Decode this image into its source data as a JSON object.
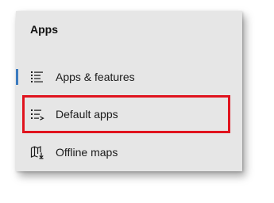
{
  "section": {
    "title": "Apps"
  },
  "nav": {
    "items": [
      {
        "label": "Apps & features",
        "icon": "apps-features-list-icon",
        "active": true
      },
      {
        "label": "Default apps",
        "icon": "default-apps-list-icon",
        "active": false
      },
      {
        "label": "Offline maps",
        "icon": "offline-map-download-icon",
        "active": false
      }
    ]
  },
  "colors": {
    "panel_bg": "#e6e6e6",
    "accent": "#3a7abf",
    "highlight": "#e0141e",
    "text": "#1a1a1a"
  }
}
